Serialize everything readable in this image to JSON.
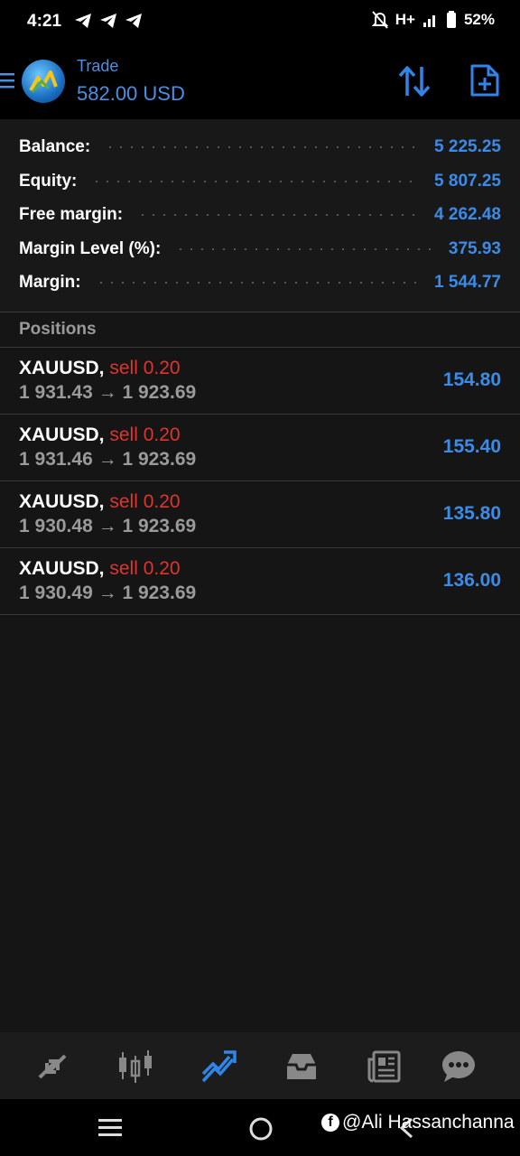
{
  "status_bar": {
    "time": "4:21",
    "network": "H+",
    "battery": "52%",
    "icons": [
      "telegram-icon",
      "telegram-icon",
      "telegram-icon",
      "mute-icon",
      "signal-icon",
      "battery-icon"
    ]
  },
  "header": {
    "title": "Trade",
    "subtitle": "582.00 USD",
    "icons": [
      "menu-icon",
      "sort-icon",
      "new-order-icon"
    ],
    "accent_color": "#4a8fe6"
  },
  "summary": [
    {
      "label": "Balance:",
      "value": "5 225.25"
    },
    {
      "label": "Equity:",
      "value": "5 807.25"
    },
    {
      "label": "Free margin:",
      "value": "4 262.48"
    },
    {
      "label": "Margin Level (%):",
      "value": "375.93"
    },
    {
      "label": "Margin:",
      "value": "1 544.77"
    }
  ],
  "positions_header": "Positions",
  "positions": [
    {
      "symbol": "XAUUSD,",
      "side": "sell 0.20",
      "open_price": "1 931.43",
      "arrow": "→",
      "current_price": "1 923.69",
      "profit": "154.80"
    },
    {
      "symbol": "XAUUSD,",
      "side": "sell 0.20",
      "open_price": "1 931.46",
      "arrow": "→",
      "current_price": "1 923.69",
      "profit": "155.40"
    },
    {
      "symbol": "XAUUSD,",
      "side": "sell 0.20",
      "open_price": "1 930.48",
      "arrow": "→",
      "current_price": "1 923.69",
      "profit": "135.80"
    },
    {
      "symbol": "XAUUSD,",
      "side": "sell 0.20",
      "open_price": "1 930.49",
      "arrow": "→",
      "current_price": "1 923.69",
      "profit": "136.00"
    }
  ],
  "bottom_nav": {
    "items": [
      "quotes-icon",
      "chart-icon",
      "trade-icon",
      "history-icon",
      "news-icon",
      "chat-icon"
    ],
    "active": "trade-icon"
  },
  "watermark": {
    "icon": "facebook-icon",
    "text": "@Ali Hassanchanna"
  },
  "colors": {
    "value_blue": "#3b8be8",
    "sell_red": "#e0342c",
    "muted_gray": "#9a9a9a"
  }
}
